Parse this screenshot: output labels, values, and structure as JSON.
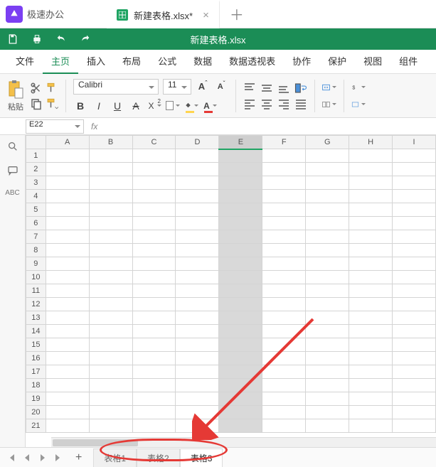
{
  "app": {
    "name": "极速办公"
  },
  "doc_tab": {
    "title": "新建表格.xlsx*",
    "plus": "＋",
    "close": "×"
  },
  "greenbar": {
    "title": "新建表格.xlsx"
  },
  "menu": {
    "items": [
      "文件",
      "主页",
      "插入",
      "布局",
      "公式",
      "数据",
      "数据透视表",
      "协作",
      "保护",
      "视图",
      "组件"
    ],
    "active": 1
  },
  "ribbon": {
    "paste": "粘贴",
    "font_name": "Calibri",
    "font_size": "11",
    "bold": "B",
    "italic": "I",
    "underline": "U",
    "strike": "A",
    "super": "X",
    "super2": "2",
    "A_label": "A"
  },
  "namebox": {
    "ref": "E22",
    "fx": "fx"
  },
  "grid": {
    "cols": [
      "A",
      "B",
      "C",
      "D",
      "E",
      "F",
      "G",
      "H",
      "I"
    ],
    "rows": 21,
    "selected_col": 4
  },
  "sheet_tabs": {
    "items": [
      "表格1",
      "表格2",
      "表格3"
    ],
    "active": 2
  },
  "side": {
    "abc": "ABC"
  }
}
